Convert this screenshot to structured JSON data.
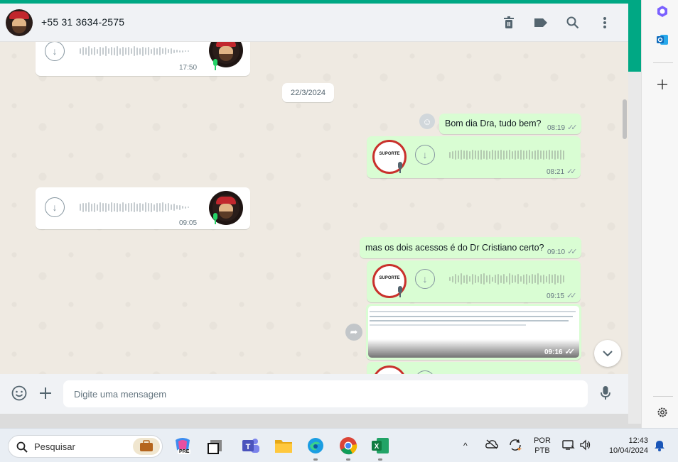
{
  "header": {
    "contact_name": "+55 31 3634-2575"
  },
  "chat": {
    "date_chip": "22/3/2024",
    "messages": [
      {
        "type": "audio-in",
        "time": "17:50"
      },
      {
        "type": "text-out",
        "text": "Bom dia Dra, tudo bem?",
        "time": "08:19"
      },
      {
        "type": "audio-out",
        "time": "08:21",
        "sender_logo_text": [
          "SUPORTE"
        ]
      },
      {
        "type": "audio-in",
        "time": "09:05"
      },
      {
        "type": "text-out",
        "text": "mas os dois acessos é do Dr Cristiano certo?",
        "time": "09:10"
      },
      {
        "type": "audio-out",
        "time": "09:15",
        "sender_logo_text": [
          "SUPORTE"
        ]
      },
      {
        "type": "image-out",
        "time": "09:16"
      }
    ]
  },
  "composer": {
    "placeholder": "Digite uma mensagem"
  },
  "taskbar": {
    "search_label": "Pesquisar",
    "copilot_badge": "PRE",
    "language_top": "POR",
    "language_bottom": "PTB",
    "clock_time": "12:43",
    "clock_date": "10/04/2024"
  },
  "colors": {
    "wa_green": "#00a884",
    "outgoing_bubble": "#d9fdd3",
    "incoming_bubble": "#ffffff",
    "chat_background": "#efeae2",
    "mic_green": "#25d366"
  }
}
